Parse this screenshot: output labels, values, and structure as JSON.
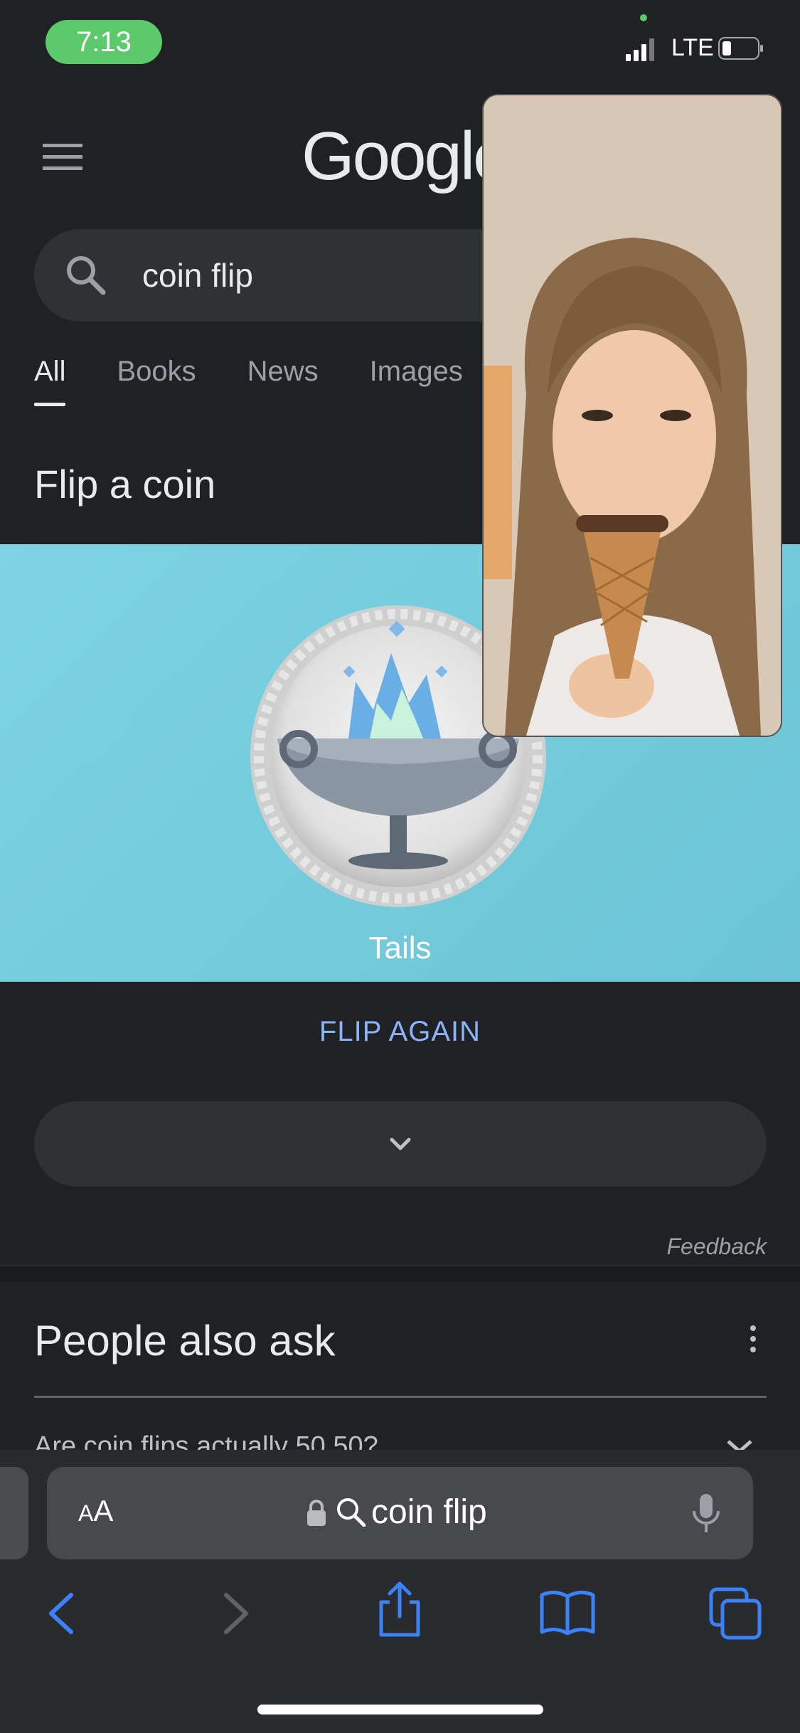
{
  "status_bar": {
    "time": "7:13",
    "network": "LTE",
    "battery_icon": "battery-low-icon",
    "signal_icon": "cellular-signal-icon"
  },
  "header": {
    "logo_text": "Google",
    "menu_icon": "hamburger-menu-icon"
  },
  "search": {
    "query": "coin flip",
    "icon": "search-icon"
  },
  "tabs": [
    {
      "label": "All",
      "active": true
    },
    {
      "label": "Books",
      "active": false
    },
    {
      "label": "News",
      "active": false
    },
    {
      "label": "Images",
      "active": false
    }
  ],
  "coin_widget": {
    "title": "Flip a coin",
    "result": "Tails",
    "flip_again_label": "FLIP AGAIN",
    "expand_icon": "chevron-down-icon",
    "feedback_label": "Feedback",
    "background_color": "#72cbdc"
  },
  "people_also_ask": {
    "title": "People also ask",
    "first_question": "Are coin flips actually 50 50?"
  },
  "browser": {
    "aa_label_small": "A",
    "aa_label_large": "A",
    "url_text": "coin flip",
    "accent_color": "#3b82f6"
  },
  "facetime_pip": {
    "description_icon": "facetime-video-preview"
  }
}
